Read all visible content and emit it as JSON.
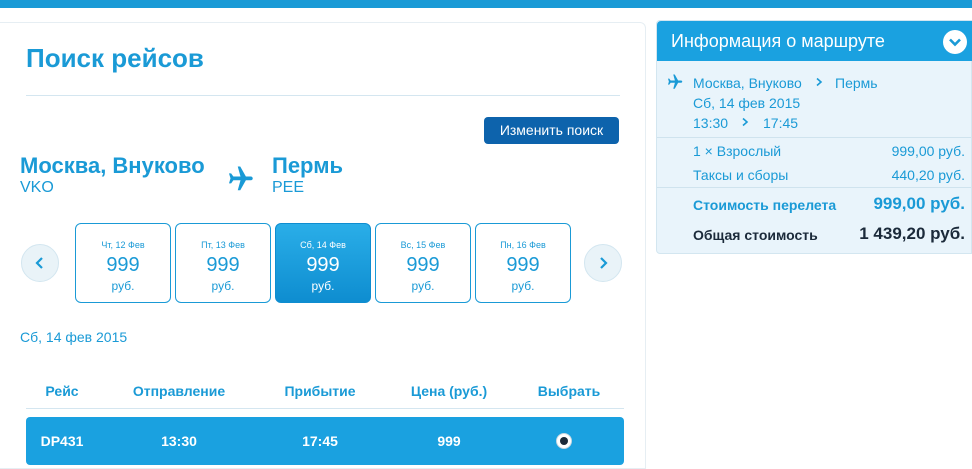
{
  "search": {
    "title": "Поиск рейсов",
    "change_button": "Изменить поиск",
    "origin": {
      "city": "Москва, Внуково",
      "code": "VKO"
    },
    "destination": {
      "city": "Пермь",
      "code": "PEE"
    }
  },
  "dates": [
    {
      "day": "Чт, 12 Фев",
      "price": "999",
      "currency": "руб.",
      "selected": false
    },
    {
      "day": "Пт, 13 Фев",
      "price": "999",
      "currency": "руб.",
      "selected": false
    },
    {
      "day": "Сб, 14 Фев",
      "price": "999",
      "currency": "руб.",
      "selected": true
    },
    {
      "day": "Вс, 15 Фев",
      "price": "999",
      "currency": "руб.",
      "selected": false
    },
    {
      "day": "Пн, 16 Фев",
      "price": "999",
      "currency": "руб.",
      "selected": false
    }
  ],
  "selected_date": "Сб, 14 фев 2015",
  "table": {
    "headers": [
      "Рейс",
      "Отправление",
      "Прибытие",
      "Цена (руб.)",
      "Выбрать"
    ],
    "rows": [
      {
        "flight": "DP431",
        "departure": "13:30",
        "arrival": "17:45",
        "price": "999",
        "selected": true
      }
    ]
  },
  "route_info": {
    "title": "Информация о маршруте",
    "from": "Москва, Внуково",
    "to": "Пермь",
    "date": "Сб, 14 фев 2015",
    "dep_time": "13:30",
    "arr_time": "17:45",
    "passengers_label": "1 × Взрослый",
    "passengers_price": "999,00 руб.",
    "taxes_label": "Таксы и сборы",
    "taxes_price": "440,20 руб.",
    "flight_cost_label": "Стоимость перелета",
    "flight_cost": "999,00 руб.",
    "total_label": "Общая стоимость",
    "total": "1 439,20 руб."
  },
  "icons": {
    "plane": "airplane-icon",
    "prev": "chevron-left-icon",
    "next": "chevron-right-icon",
    "toggle": "chevron-down-icon",
    "route_arrow": "chevron-right-icon"
  },
  "colors": {
    "accent": "#1a9ad6",
    "button": "#0d63ac",
    "row": "#1aa1e0",
    "panel": "#e9f4fb"
  }
}
